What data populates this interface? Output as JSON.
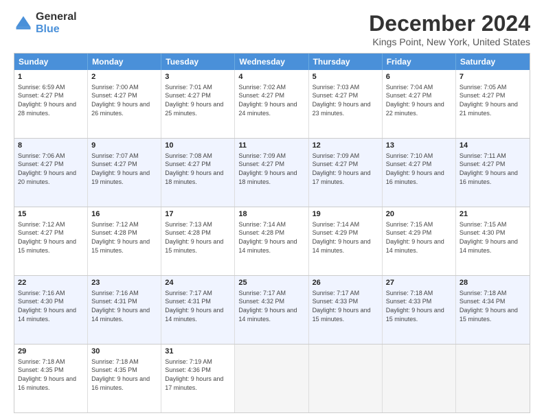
{
  "logo": {
    "general": "General",
    "blue": "Blue"
  },
  "title": "December 2024",
  "subtitle": "Kings Point, New York, United States",
  "weekdays": [
    "Sunday",
    "Monday",
    "Tuesday",
    "Wednesday",
    "Thursday",
    "Friday",
    "Saturday"
  ],
  "rows": [
    [
      {
        "day": "1",
        "sunrise": "6:59 AM",
        "sunset": "4:27 PM",
        "daylight": "9 hours and 28 minutes."
      },
      {
        "day": "2",
        "sunrise": "7:00 AM",
        "sunset": "4:27 PM",
        "daylight": "9 hours and 26 minutes."
      },
      {
        "day": "3",
        "sunrise": "7:01 AM",
        "sunset": "4:27 PM",
        "daylight": "9 hours and 25 minutes."
      },
      {
        "day": "4",
        "sunrise": "7:02 AM",
        "sunset": "4:27 PM",
        "daylight": "9 hours and 24 minutes."
      },
      {
        "day": "5",
        "sunrise": "7:03 AM",
        "sunset": "4:27 PM",
        "daylight": "9 hours and 23 minutes."
      },
      {
        "day": "6",
        "sunrise": "7:04 AM",
        "sunset": "4:27 PM",
        "daylight": "9 hours and 22 minutes."
      },
      {
        "day": "7",
        "sunrise": "7:05 AM",
        "sunset": "4:27 PM",
        "daylight": "9 hours and 21 minutes."
      }
    ],
    [
      {
        "day": "8",
        "sunrise": "7:06 AM",
        "sunset": "4:27 PM",
        "daylight": "9 hours and 20 minutes."
      },
      {
        "day": "9",
        "sunrise": "7:07 AM",
        "sunset": "4:27 PM",
        "daylight": "9 hours and 19 minutes."
      },
      {
        "day": "10",
        "sunrise": "7:08 AM",
        "sunset": "4:27 PM",
        "daylight": "9 hours and 18 minutes."
      },
      {
        "day": "11",
        "sunrise": "7:09 AM",
        "sunset": "4:27 PM",
        "daylight": "9 hours and 18 minutes."
      },
      {
        "day": "12",
        "sunrise": "7:09 AM",
        "sunset": "4:27 PM",
        "daylight": "9 hours and 17 minutes."
      },
      {
        "day": "13",
        "sunrise": "7:10 AM",
        "sunset": "4:27 PM",
        "daylight": "9 hours and 16 minutes."
      },
      {
        "day": "14",
        "sunrise": "7:11 AM",
        "sunset": "4:27 PM",
        "daylight": "9 hours and 16 minutes."
      }
    ],
    [
      {
        "day": "15",
        "sunrise": "7:12 AM",
        "sunset": "4:27 PM",
        "daylight": "9 hours and 15 minutes."
      },
      {
        "day": "16",
        "sunrise": "7:12 AM",
        "sunset": "4:28 PM",
        "daylight": "9 hours and 15 minutes."
      },
      {
        "day": "17",
        "sunrise": "7:13 AM",
        "sunset": "4:28 PM",
        "daylight": "9 hours and 15 minutes."
      },
      {
        "day": "18",
        "sunrise": "7:14 AM",
        "sunset": "4:28 PM",
        "daylight": "9 hours and 14 minutes."
      },
      {
        "day": "19",
        "sunrise": "7:14 AM",
        "sunset": "4:29 PM",
        "daylight": "9 hours and 14 minutes."
      },
      {
        "day": "20",
        "sunrise": "7:15 AM",
        "sunset": "4:29 PM",
        "daylight": "9 hours and 14 minutes."
      },
      {
        "day": "21",
        "sunrise": "7:15 AM",
        "sunset": "4:30 PM",
        "daylight": "9 hours and 14 minutes."
      }
    ],
    [
      {
        "day": "22",
        "sunrise": "7:16 AM",
        "sunset": "4:30 PM",
        "daylight": "9 hours and 14 minutes."
      },
      {
        "day": "23",
        "sunrise": "7:16 AM",
        "sunset": "4:31 PM",
        "daylight": "9 hours and 14 minutes."
      },
      {
        "day": "24",
        "sunrise": "7:17 AM",
        "sunset": "4:31 PM",
        "daylight": "9 hours and 14 minutes."
      },
      {
        "day": "25",
        "sunrise": "7:17 AM",
        "sunset": "4:32 PM",
        "daylight": "9 hours and 14 minutes."
      },
      {
        "day": "26",
        "sunrise": "7:17 AM",
        "sunset": "4:33 PM",
        "daylight": "9 hours and 15 minutes."
      },
      {
        "day": "27",
        "sunrise": "7:18 AM",
        "sunset": "4:33 PM",
        "daylight": "9 hours and 15 minutes."
      },
      {
        "day": "28",
        "sunrise": "7:18 AM",
        "sunset": "4:34 PM",
        "daylight": "9 hours and 15 minutes."
      }
    ],
    [
      {
        "day": "29",
        "sunrise": "7:18 AM",
        "sunset": "4:35 PM",
        "daylight": "9 hours and 16 minutes."
      },
      {
        "day": "30",
        "sunrise": "7:18 AM",
        "sunset": "4:35 PM",
        "daylight": "9 hours and 16 minutes."
      },
      {
        "day": "31",
        "sunrise": "7:19 AM",
        "sunset": "4:36 PM",
        "daylight": "9 hours and 17 minutes."
      },
      null,
      null,
      null,
      null
    ]
  ],
  "labels": {
    "sunrise": "Sunrise:",
    "sunset": "Sunset:",
    "daylight": "Daylight:"
  },
  "colors": {
    "header_bg": "#4a90d9",
    "alt_row_bg": "#eef2fb",
    "cell_bg": "#ffffff"
  }
}
